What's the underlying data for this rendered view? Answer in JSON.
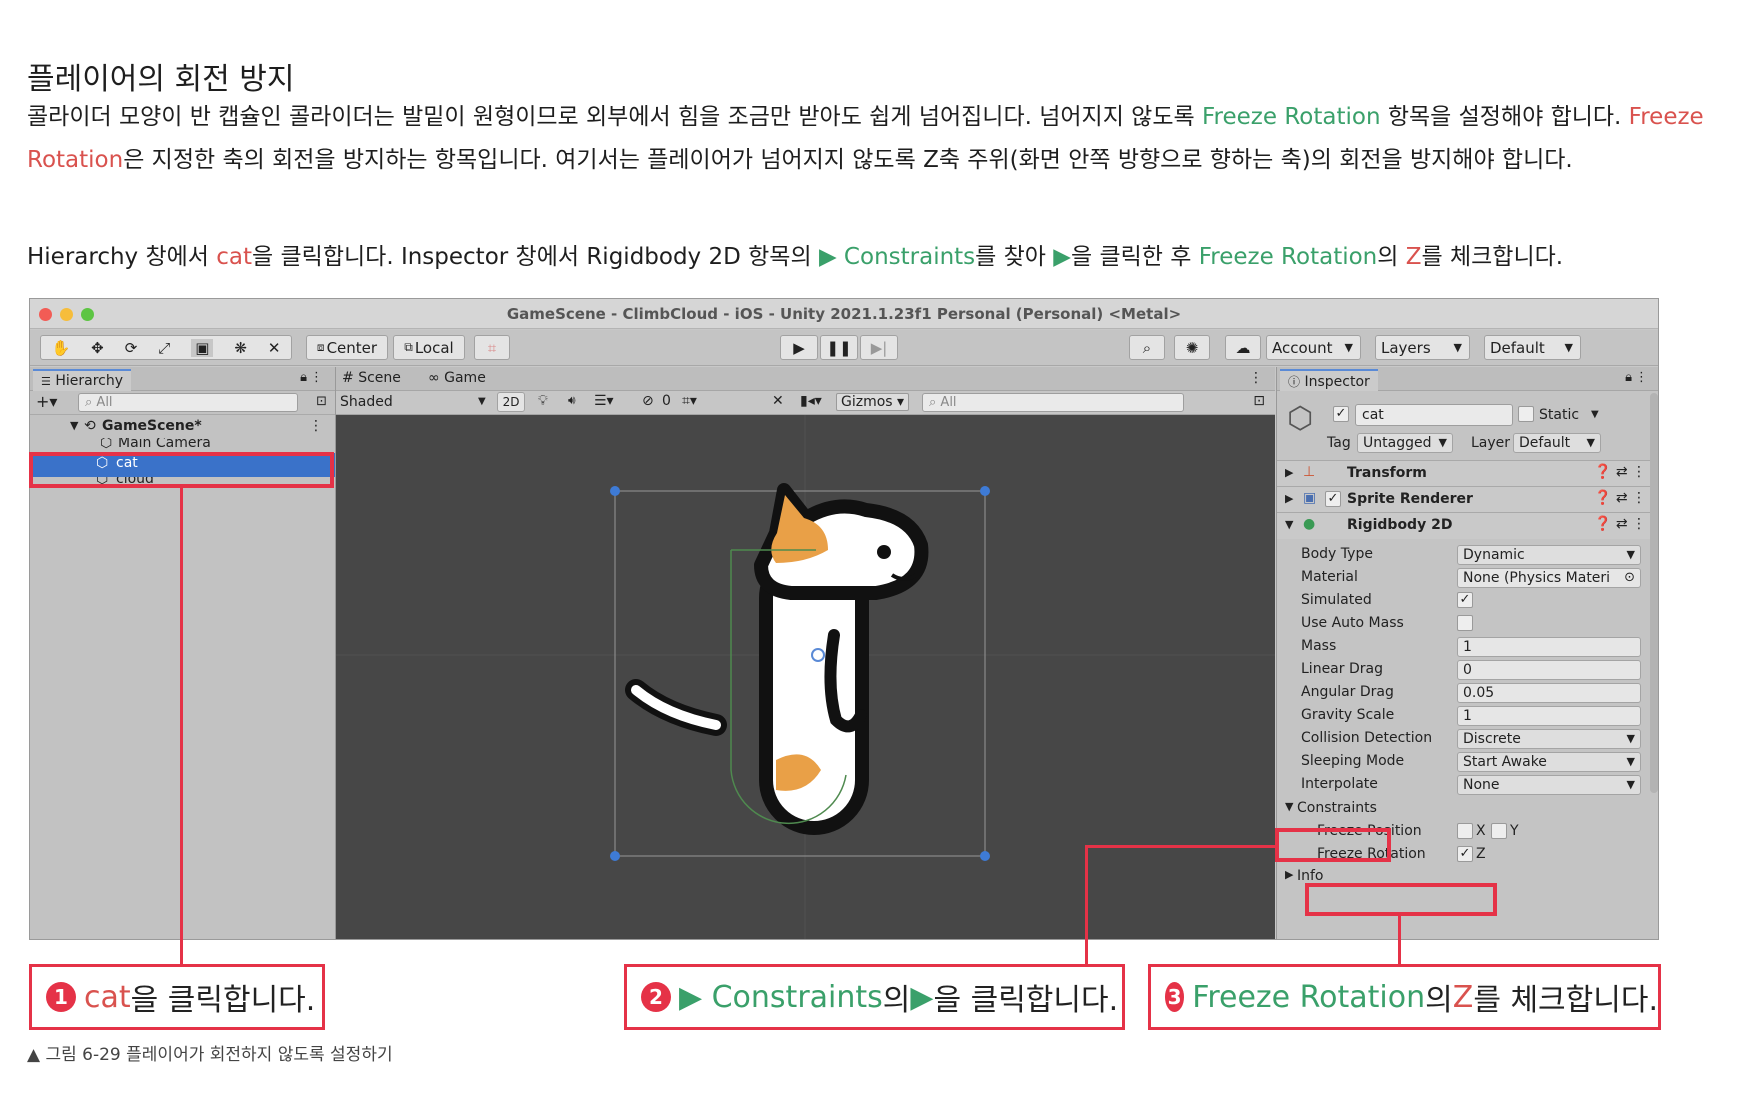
{
  "article": {
    "heading": "플레이어의 회전 방지",
    "p1_a": "콜라이더 모양이 반 캡슐인 콜라이더는 발밑이 원형이므로 외부에서 힘을 조금만 받아도 쉽게 넘어집니다. 넘어지지 않도록 ",
    "p1_b": "Freeze Rotation",
    "p1_c": " 항목을 설정해야 합니다. ",
    "p1_d": "Freeze Rotation",
    "p1_e": "은 지정한 축의 회전을 방지하는 항목입니다. 여기서는 플레이어가 넘어지지 않도록 Z축 주위(화면 안쪽 방향으로 향하는 축)의 회전을 방지해야 합니다.",
    "p2_a": "Hierarchy 창에서 ",
    "p2_b": "cat",
    "p2_c": "을 클릭합니다. Inspector 창에서 Rigidbody 2D 항목의 ",
    "p2_d": "▶ Constraints",
    "p2_e": "를 찾아 ",
    "p2_f": "▶",
    "p2_g": "을 클릭한 후 ",
    "p2_h": "Freeze Rotation",
    "p2_i": "의 ",
    "p2_j": "Z",
    "p2_k": "를 체크합니다."
  },
  "window": {
    "title": "GameScene - ClimbCloud - iOS - Unity 2021.1.23f1 Personal (Personal) <Metal>"
  },
  "toolbar": {
    "pivot_label": "Center",
    "space_label": "Local",
    "account_label": "Account",
    "layers_label": "Layers",
    "layout_label": "Default"
  },
  "hierarchy": {
    "tab_label": "Hierarchy",
    "search_placeholder": "All",
    "scene_name": "GameScene*",
    "items": [
      {
        "label": "Main Camera"
      },
      {
        "label": "cat"
      },
      {
        "label": "cloud"
      }
    ]
  },
  "scene_view": {
    "tab_scene": "Scene",
    "tab_game": "Game",
    "shading_mode": "Shaded",
    "mode_2d": "2D",
    "hidden_count": "0",
    "gizmos_label": "Gizmos",
    "search_placeholder": "All"
  },
  "inspector": {
    "tab_label": "Inspector",
    "object_name": "cat",
    "static_label": "Static",
    "tag_label": "Tag",
    "tag_value": "Untagged",
    "layer_label": "Layer",
    "layer_value": "Default",
    "components": [
      "Transform",
      "Sprite Renderer",
      "Rigidbody 2D"
    ],
    "properties": {
      "body_type_label": "Body Type",
      "body_type": "Dynamic",
      "material_label": "Material",
      "material": "None (Physics Materi",
      "simulated_label": "Simulated",
      "use_auto_mass_label": "Use Auto Mass",
      "mass_label": "Mass",
      "mass": "1",
      "linear_drag_label": "Linear Drag",
      "linear_drag": "0",
      "angular_drag_label": "Angular Drag",
      "angular_drag": "0.05",
      "gravity_scale_label": "Gravity Scale",
      "gravity_scale": "1",
      "collision_detection_label": "Collision Detection",
      "collision_detection": "Discrete",
      "sleeping_mode_label": "Sleeping Mode",
      "sleeping_mode": "Start Awake",
      "interpolate_label": "Interpolate",
      "interpolate": "None"
    },
    "constraints_label": "Constraints",
    "freeze_position_label": "Freeze Position",
    "freeze_rotation_label": "Freeze Rotation",
    "axis_x": "X",
    "axis_y": "Y",
    "axis_z": "Z",
    "info_label": "Info"
  },
  "callouts": {
    "c1_num": "1",
    "c1_a": "cat",
    "c1_b": "을 클릭합니다.",
    "c2_num": "2",
    "c2_a": "▶ Constraints",
    "c2_b": "의 ",
    "c2_c": "▶",
    "c2_d": "을 클릭합니다.",
    "c3_num": "3",
    "c3_a": "Freeze Rotation",
    "c3_b": "의 ",
    "c3_c": "Z",
    "c3_d": "를 체크합니다."
  },
  "caption": "▲ 그림 6-29 플레이어가 회전하지 않도록 설정하기",
  "colors": {
    "highlight": "#e53247",
    "link_green": "#3aa06a",
    "link_red": "#d9524e",
    "selection": "#3a72c9",
    "scene_bg": "#474747"
  }
}
